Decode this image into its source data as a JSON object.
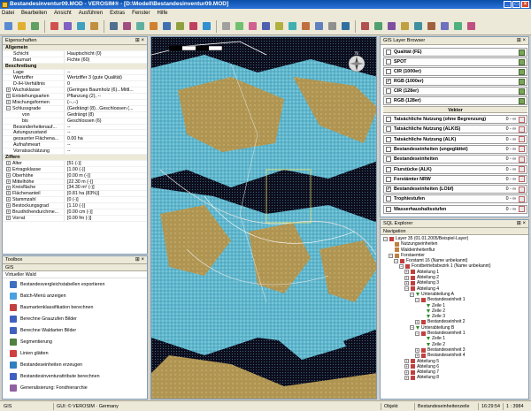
{
  "window": {
    "title": "Bestandesinventur09.MOD - VEROSIM® - [D:\\Modell\\Bestandesinventur09.MOD]"
  },
  "menu": [
    "Datei",
    "Bearbeiten",
    "Ansicht",
    "Ausführen",
    "Extras",
    "Fenster",
    "Hilfe"
  ],
  "properties": {
    "title": "Eigenschaften",
    "rows": [
      {
        "type": "cat",
        "k": "Allgemein"
      },
      {
        "k": "Schicht",
        "v": "Hauptschicht (0)"
      },
      {
        "k": "Baumart",
        "v": "Fichte (60)"
      },
      {
        "type": "cat",
        "k": "Beschreibung"
      },
      {
        "k": "Lage",
        "v": "--"
      },
      {
        "k": "Wertziffer",
        "v": "Wertziffer 3 (gute Qualität)"
      },
      {
        "k": "D-/H-Verhältnis",
        "v": "0"
      },
      {
        "k": "Wuchsklasse",
        "v": "{Geringes Baumholz (6)...Mittl...",
        "pm": "+"
      },
      {
        "k": "Entstehungsarten",
        "v": "Pflanzung (2), --",
        "pm": "+"
      },
      {
        "k": "Mischungsformen",
        "v": "{--,--}",
        "pm": "+"
      },
      {
        "k": "Schlussgrade",
        "v": "{Gedrängt (8)...Geschlossen (...",
        "pm": "−"
      },
      {
        "k": "von",
        "v": "Gedrängt (8)",
        "indent": true
      },
      {
        "k": "bis",
        "v": "Geschlossen (6)",
        "indent": true
      },
      {
        "k": "Besonderheitenauf...",
        "v": "--"
      },
      {
        "k": "Astungszustand",
        "v": "--"
      },
      {
        "k": "gezaunter Flächena...",
        "v": "0.00 ha"
      },
      {
        "k": "Aufnahmeart",
        "v": "--"
      },
      {
        "k": "Vorratsschätzung",
        "v": "--"
      },
      {
        "type": "cat",
        "k": "Ziffern"
      },
      {
        "k": "Alter",
        "v": "[51 (-)]",
        "pm": "+"
      },
      {
        "k": "Ertragsklasse",
        "v": "[1.00 (-)]",
        "pm": "+"
      },
      {
        "k": "Oberhöhe",
        "v": "[0.00 m (-)]",
        "pm": "+"
      },
      {
        "k": "Mittelhöhe",
        "v": "[22.30 m (-)]",
        "pm": "+"
      },
      {
        "k": "Kreisfläche",
        "v": "[34.30 m² (-)]",
        "pm": "+"
      },
      {
        "k": "Flächenanteil",
        "v": "[0.81 ha (83%)]",
        "pm": "+"
      },
      {
        "k": "Stammzahl",
        "v": "[0 (-)]",
        "pm": "+"
      },
      {
        "k": "Bestockungsgrad",
        "v": "[1.10 (-)]",
        "pm": "+"
      },
      {
        "k": "Brusthöhendurchme...",
        "v": "[0.00 cm (-)]",
        "pm": "+"
      },
      {
        "k": "Vorrat",
        "v": "[0.00 fm (-)]",
        "pm": "+"
      }
    ]
  },
  "toolbox": {
    "title": "Toolbox",
    "section": "GIS",
    "subtitle": "Virtueller Wald",
    "items": [
      {
        "label": "Bestandesvergleichstabellen exportieren",
        "color": "#3b6fc0"
      },
      {
        "label": "Batch-Menü anzeigen",
        "color": "#4aa0e0"
      },
      {
        "label": "Baumartenklassifikation berechnen",
        "color": "#c04040"
      },
      {
        "label": "Berechne Grauzufen Bilder",
        "color": "#4060c0"
      },
      {
        "label": "Berechne Waldarten Bilder",
        "color": "#4060c0"
      },
      {
        "label": "Segmentierung",
        "color": "#508040"
      },
      {
        "label": "Linien glätten",
        "color": "#d04040"
      },
      {
        "label": "Bestandeseinheiten erzeugen",
        "color": "#3080c0"
      },
      {
        "label": "Bestandesinventurattribute berechnen",
        "color": "#4060c0"
      },
      {
        "label": "Generalisierung: Forsthierarchie",
        "color": "#9060a0"
      }
    ]
  },
  "layers": {
    "title": "GIS Layer Browser",
    "raster": [
      {
        "name": "Qualität (FE)",
        "checked": false
      },
      {
        "name": "SPOT",
        "checked": false
      },
      {
        "name": "CIR (1000er)",
        "checked": false
      },
      {
        "name": "RGB (1000er)",
        "checked": true
      },
      {
        "name": "CIR (128er)",
        "checked": false
      },
      {
        "name": "RGB (128er)",
        "checked": false
      }
    ],
    "vektor_label": "Vektor",
    "vector": [
      {
        "name": "Tatsächliche Nutzung (ohne Begrenzung)",
        "range": "0 - ∞",
        "checked": false
      },
      {
        "name": "Tatsächliche Nutzung (ALKIS)",
        "range": "0 - ∞",
        "checked": false
      },
      {
        "name": "Tatsächliche Nutzung (ALK)",
        "range": "0 - ∞",
        "checked": false
      },
      {
        "name": "Bestandeseinheiten (ungeglättet)",
        "range": "0 - ∞",
        "checked": false
      },
      {
        "name": "Bestandeseinheiten",
        "range": "0 - ∞",
        "checked": false
      },
      {
        "name": "Flurstücke (ALK)",
        "range": "0 - ∞",
        "checked": false
      },
      {
        "name": "Forstämter NRW",
        "range": "0 - ∞",
        "checked": false
      },
      {
        "name": "Bestandeseinheiten (LÖbf)",
        "range": "0 - ∞",
        "checked": true
      },
      {
        "name": "Trophiestufen",
        "range": "0 - ∞",
        "checked": false
      },
      {
        "name": "Wasserhaushaltsstufen",
        "range": "0 - ∞",
        "checked": false
      }
    ]
  },
  "sql": {
    "title": "SQL Explorer",
    "nav_label": "Navigation",
    "rows": [
      {
        "d": 0,
        "t": "−",
        "i": "#c04040",
        "label": "Layer 35 (01.01.2005/Beispiel-Layer)"
      },
      {
        "d": 1,
        "t": "",
        "i": "#c08040",
        "label": "Nutzungseinheiten"
      },
      {
        "d": 1,
        "t": "",
        "i": "#c08040",
        "label": "Waldeinheitenflur"
      },
      {
        "d": 1,
        "t": "−",
        "i": "#c08040",
        "label": "Forstaemter"
      },
      {
        "d": 2,
        "t": "−",
        "i": "#c04040",
        "label": "Forstamt 16 (Name unbekannt)"
      },
      {
        "d": 3,
        "t": "−",
        "i": "#c04040",
        "label": "Forstbetriebsbezirk 1 (Name unbekannt)"
      },
      {
        "d": 4,
        "t": "+",
        "i": "#c04040",
        "label": "Abteilung 1"
      },
      {
        "d": 4,
        "t": "+",
        "i": "#c04040",
        "label": "Abteilung 2"
      },
      {
        "d": 4,
        "t": "+",
        "i": "#c04040",
        "label": "Abteilung 3"
      },
      {
        "d": 4,
        "t": "−",
        "i": "#c04040",
        "label": "Abteilung 4"
      },
      {
        "d": 5,
        "t": "−",
        "i": "tri",
        "label": "Unterabteilung A"
      },
      {
        "d": 6,
        "t": "−",
        "i": "#c04040",
        "label": "Bestandeseinheit 1"
      },
      {
        "d": 7,
        "t": "",
        "i": "tri",
        "label": "Zeile 1"
      },
      {
        "d": 7,
        "t": "",
        "i": "tri",
        "label": "Zeile 2"
      },
      {
        "d": 7,
        "t": "",
        "i": "tri",
        "label": "Zeile 3"
      },
      {
        "d": 6,
        "t": "+",
        "i": "#c04040",
        "label": "Bestandeseinheit 2"
      },
      {
        "d": 5,
        "t": "−",
        "i": "tri",
        "label": "Unterabteilung B"
      },
      {
        "d": 6,
        "t": "−",
        "i": "#c04040",
        "label": "Bestandeseinheit 1"
      },
      {
        "d": 7,
        "t": "",
        "i": "tri",
        "label": "Zeile 1"
      },
      {
        "d": 7,
        "t": "",
        "i": "tri",
        "label": "Zeile 2"
      },
      {
        "d": 6,
        "t": "+",
        "i": "#c04040",
        "label": "Bestandeseinheit 3"
      },
      {
        "d": 6,
        "t": "+",
        "i": "#c04040",
        "label": "Bestandeseinheit 4"
      },
      {
        "d": 4,
        "t": "+",
        "i": "#c04040",
        "label": "Abteilung 5"
      },
      {
        "d": 4,
        "t": "+",
        "i": "#c04040",
        "label": "Abteilung 6"
      },
      {
        "d": 4,
        "t": "+",
        "i": "#c04040",
        "label": "Abteilung 7"
      },
      {
        "d": 4,
        "t": "+",
        "i": "#c04040",
        "label": "Abteilung 8"
      }
    ]
  },
  "status": {
    "left": "GIS",
    "center": "GUI: © VEROSIM · Germany",
    "object": "Objekt",
    "selection": "Bestandeseinheitenzeile",
    "time": "16:29:54",
    "zoom": "1 : 3984"
  },
  "colors": {
    "water": "#6cc2d6",
    "land": "#b59a56",
    "dark": "#0b0b1a",
    "accent": "#0a4ea8"
  }
}
